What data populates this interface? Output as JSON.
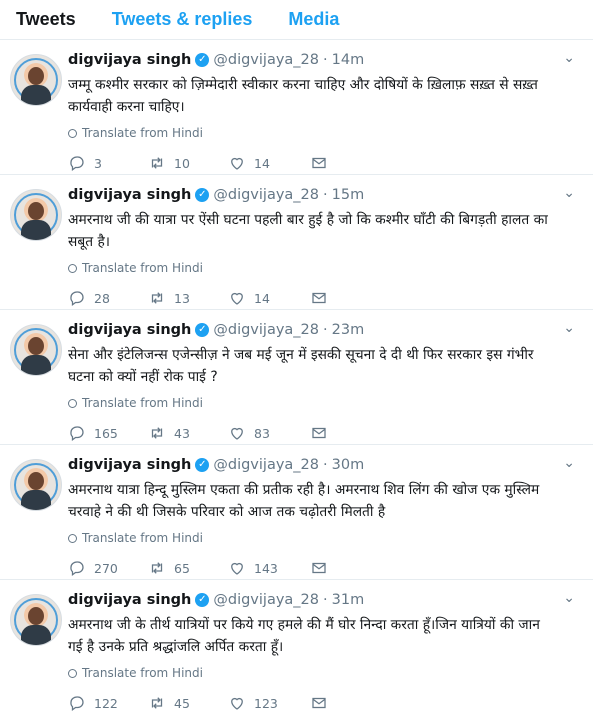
{
  "tabs": [
    {
      "label": "Tweets",
      "active": true
    },
    {
      "label": "Tweets & replies",
      "active": false
    },
    {
      "label": "Media",
      "active": false
    }
  ],
  "tweets": [
    {
      "name": "digvijaya singh",
      "handle": "@digvijaya_28",
      "time": "14m",
      "text": "जम्मू कश्मीर सरकार को ज़िम्मेदारी स्वीकार करना चाहिए और दोषियों के ख़िलाफ़ सख़्त से सख़्त कार्यवाही करना चाहिए।",
      "translate": "Translate from Hindi",
      "replies": "3",
      "retweets": "10",
      "likes": "14"
    },
    {
      "name": "digvijaya singh",
      "handle": "@digvijaya_28",
      "time": "15m",
      "text": "अमरनाथ जी की यात्रा पर ऐंसी घटना पहली बार हुई है जो कि कश्मीर घाँटी की बिगड़ती हालत का सबूत है।",
      "translate": "Translate from Hindi",
      "replies": "28",
      "retweets": "13",
      "likes": "14"
    },
    {
      "name": "digvijaya singh",
      "handle": "@digvijaya_28",
      "time": "23m",
      "text": "सेना और इंटेलिजन्स एजेन्सीज़ ने जब मई जून में इसकी सूचना दे दी थी फिर सरकार इस गंभीर घटना को क्यों नहीं रोक पाई ?",
      "translate": "Translate from Hindi",
      "replies": "165",
      "retweets": "43",
      "likes": "83"
    },
    {
      "name": "digvijaya singh",
      "handle": "@digvijaya_28",
      "time": "30m",
      "text": "अमरनाथ यात्रा हिन्दू मुस्लिम एकता की प्रतीक रही है। अमरनाथ शिव लिंग की खोज एक मुस्लिम चरवाहे ने की थी जिसके परिवार को आज तक चढ़ोतरी मिलती है",
      "translate": "Translate from Hindi",
      "replies": "270",
      "retweets": "65",
      "likes": "143"
    },
    {
      "name": "digvijaya singh",
      "handle": "@digvijaya_28",
      "time": "31m",
      "text": "अमरनाथ जी के तीर्थ यात्रियों पर किये गए हमले की मैं घोर निन्दा करता हूँ।जिन यात्रियों की जान गई है उनके प्रति श्रद्धांजलि अर्पित करता हूँ।",
      "translate": "Translate from Hindi",
      "replies": "122",
      "retweets": "45",
      "likes": "123"
    }
  ],
  "icons": {
    "verified": "verified-badge-icon",
    "translate": "globe-icon",
    "reply": "reply-icon",
    "retweet": "retweet-icon",
    "like": "heart-icon",
    "message": "envelope-icon",
    "menu": "chevron-down-icon"
  },
  "colors": {
    "accent": "#1da1f2",
    "muted": "#657786",
    "text": "#14171a",
    "divider": "#e6ecf0"
  }
}
